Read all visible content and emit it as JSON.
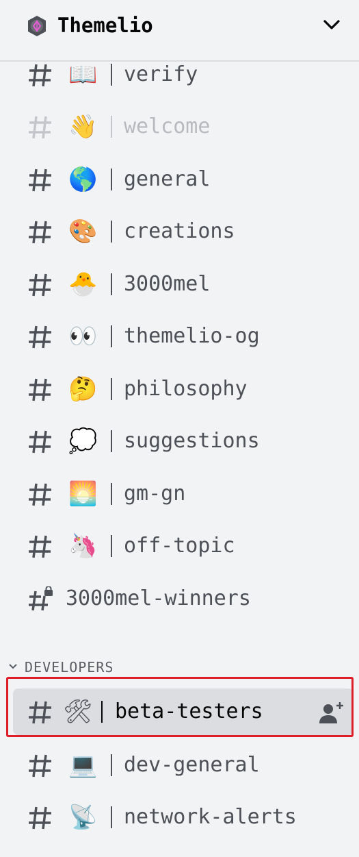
{
  "server": {
    "name": "Themelio",
    "icon": "hexagon-server-icon"
  },
  "channels": [
    {
      "emoji": "📖",
      "name": "verify"
    },
    {
      "emoji": "👋",
      "name": "welcome"
    },
    {
      "emoji": "🌎",
      "name": "general"
    },
    {
      "emoji": "🎨",
      "name": "creations"
    },
    {
      "emoji": "🐣",
      "name": "3000mel"
    },
    {
      "emoji": "👀",
      "name": "themelio-og"
    },
    {
      "emoji": "🤔",
      "name": "philosophy"
    },
    {
      "emoji": "💭",
      "name": "suggestions"
    },
    {
      "emoji": "🌅",
      "name": "gm-gn"
    },
    {
      "emoji": "🦄",
      "name": "off-topic"
    },
    {
      "name": "3000mel-winners",
      "icon": "locked-hash-icon"
    }
  ],
  "category": {
    "label": "DEVELOPERS"
  },
  "dev_channels": [
    {
      "emoji": "🛠",
      "name": "beta-testers",
      "selected": true,
      "action_icon": "add-member-icon"
    },
    {
      "emoji": "💻",
      "name": "dev-general"
    },
    {
      "emoji": "📡",
      "name": "network-alerts"
    }
  ],
  "colors": {
    "background": "#f2f3f5",
    "text": "#4e5058",
    "muted_text": "#b7b9bf",
    "selected_bg": "#dcdde1",
    "highlight_outline": "#e01e2a"
  }
}
